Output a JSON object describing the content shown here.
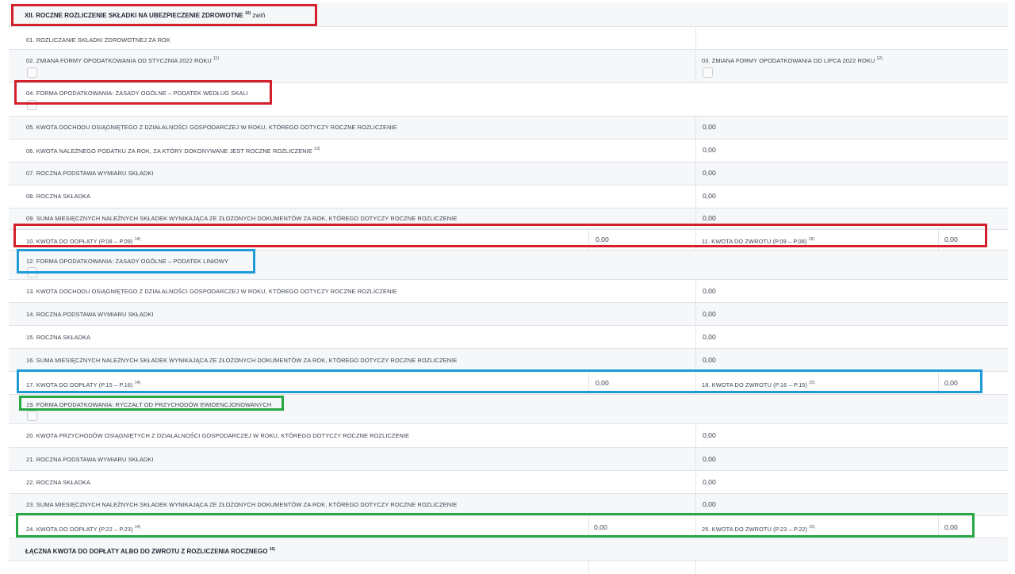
{
  "section": {
    "title": "XII. ROCZNE ROZLICZENIE SKŁADKI NA UBEZPIECZENIE ZDROWOTNE",
    "title_sup": "10)",
    "collapse_label": "zwiń"
  },
  "rows": {
    "r01": {
      "label": "01. ROZLICZANIE SKŁADKI ZDROWOTNEJ ZA ROK"
    },
    "r02": {
      "label": "02. ZMIANA FORMY OPODATKOWANIA OD STYCZNIA 2022 ROKU",
      "sup": "11)"
    },
    "r03": {
      "label": "03. ZMIANA FORMY OPODATKOWANIA OD LIPCA 2022 ROKU",
      "sup": "12)"
    },
    "r04": {
      "label": "04. FORMA OPODATKOWANIA: ZASADY OGÓLNE – PODATEK WEDŁUG SKALI"
    },
    "r05": {
      "label": "05. KWOTA DOCHODU OSIĄGNIĘTEGO Z DZIAŁALNOŚCI GOSPODARCZEJ W ROKU, KTÓREGO DOTYCZY ROCZNE ROZLICZENIE",
      "value": "0,00"
    },
    "r06": {
      "label": "06. KWOTA NALEŻNEGO PODATKU ZA ROK, ZA KTÓRY DOKONYWANE JEST ROCZNE ROZLICZENIE",
      "sup": "13)",
      "value": "0,00"
    },
    "r07": {
      "label": "07. ROCZNA PODSTAWA WYMIARU SKŁADKI",
      "value": "0,00"
    },
    "r08": {
      "label": "08. ROCZNA SKŁADKA",
      "value": "0,00"
    },
    "r09": {
      "label": "09. SUMA MIESIĘCZNYCH NALEŻNYCH SKŁADEK WYNIKAJĄCA ZE ZŁOŻONYCH DOKUMENTÓW ZA ROK, KTÓREGO DOTYCZY ROCZNE ROZLICZENIE",
      "value": "0,00"
    },
    "r10": {
      "label": "10. KWOTA DO DOPŁATY (P.08 – P.09)",
      "sup": "14)",
      "value": "0,00"
    },
    "r11": {
      "label": "11. KWOTA DO ZWROTU (P.09 – P.08)",
      "sup": "15)",
      "value": "0,00"
    },
    "r12": {
      "label": "12. FORMA OPODATKOWANIA: ZASADY OGÓLNE – PODATEK LINIOWY"
    },
    "r13": {
      "label": "13. KWOTA DOCHODU OSIĄGNIĘTEGO Z DZIAŁALNOŚCI GOSPODARCZEJ W ROKU, KTÓREGO DOTYCZY ROCZNE ROZLICZENIE",
      "value": "0,00"
    },
    "r14": {
      "label": "14. ROCZNA PODSTAWA WYMIARU SKŁADKI",
      "value": "0,00"
    },
    "r15": {
      "label": "15. ROCZNA SKŁADKA",
      "value": "0,00"
    },
    "r16": {
      "label": "16. SUMA MIESIĘCZNYCH NALEŻNYCH SKŁADEK WYNIKAJĄCA ZE ZŁOŻONYCH DOKUMENTÓW ZA ROK, KTÓREGO DOTYCZY ROCZNE ROZLICZENIE",
      "value": "0,00"
    },
    "r17": {
      "label": "17. KWOTA DO DOPŁATY (P.15 – P.16)",
      "sup": "14)",
      "value": "0,00"
    },
    "r18": {
      "label": "18. KWOTA DO ZWROTU (P.16 – P.15)",
      "sup": "15)",
      "value": "0,00"
    },
    "r19": {
      "label": "19. FORMA OPODATKOWANIA: RYCZAŁT OD PRZYCHODÓW EWIDENCJONOWANYCH"
    },
    "r20": {
      "label": "20. KWOTA PRZYCHODÓW OSIĄGNIĘTYCH Z DZIAŁALNOŚCI GOSPODARCZEJ W ROKU, KTÓREGO DOTYCZY ROCZNE ROZLICZENIE",
      "value": "0,00"
    },
    "r21": {
      "label": "21. ROCZNA PODSTAWA WYMIARU SKŁADKI",
      "value": "0,00"
    },
    "r22": {
      "label": "22. ROCZNA SKŁADKA",
      "value": "0,00"
    },
    "r23": {
      "label": "23. SUMA MIESIĘCZNYCH NALEŻNYCH SKŁADEK WYNIKAJĄCA ZE ZŁOŻONYCH DOKUMENTÓW ZA ROK, KTÓREGO DOTYCZY ROCZNE ROZLICZENIE",
      "value": "0,00"
    },
    "r24": {
      "label": "24. KWOTA DO DOPŁATY (P.22 – P.23)",
      "sup": "14)",
      "value": "0,00"
    },
    "r25": {
      "label": "25. KWOTA DO ZWROTU (P.23 – P.22)",
      "sup": "15)",
      "value": "0,00"
    }
  },
  "total": {
    "label": "ŁĄCZNA KWOTA DO DOPŁATY ALBO DO ZWROTU Z ROZLICZENIA ROCZNEGO",
    "sup": "16)"
  },
  "colors": {
    "red": "#d3202a",
    "blue": "#1e9bd7",
    "green": "#28a745",
    "row_shade": "#f6f7f9"
  }
}
